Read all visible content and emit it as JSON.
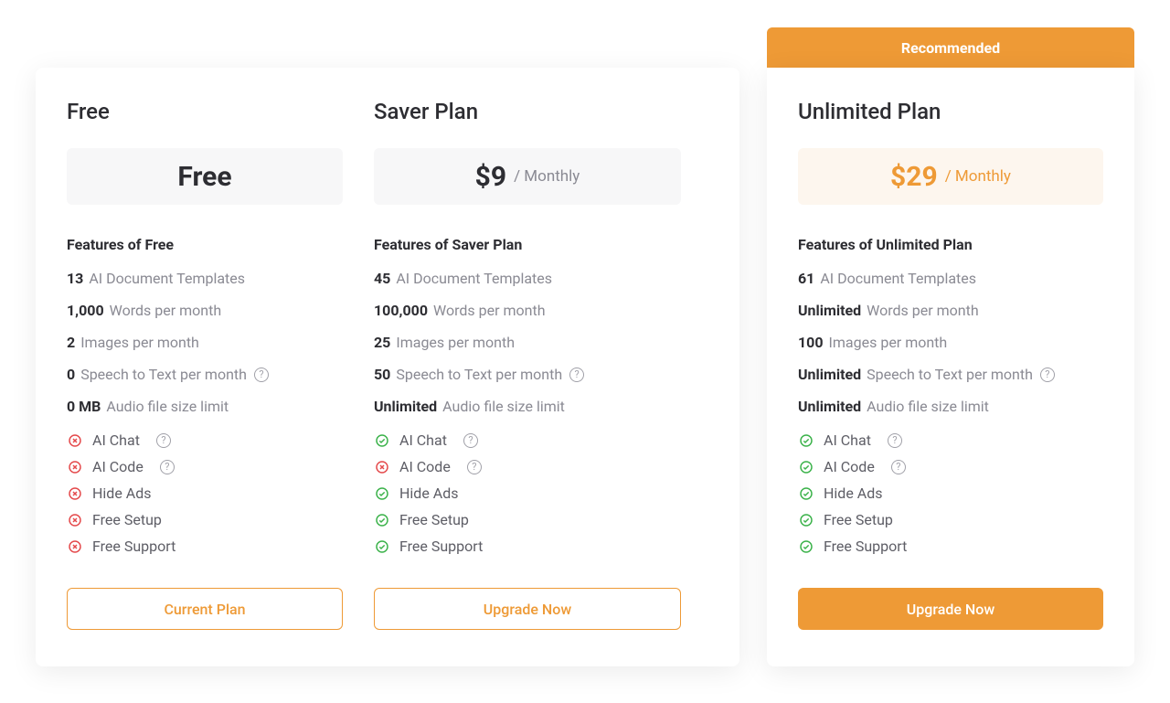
{
  "labels": {
    "recommended": "Recommended",
    "features_of": "Features of",
    "period": "/ Monthly",
    "feat_templates": "AI Document Templates",
    "feat_words": "Words per month",
    "feat_images": "Images per month",
    "feat_speech": "Speech to Text per month",
    "feat_audio": "Audio file size limit",
    "chk_chat": "AI Chat",
    "chk_code": "AI Code",
    "chk_ads": "Hide Ads",
    "chk_setup": "Free Setup",
    "chk_support": "Free Support",
    "btn_current": "Current Plan",
    "btn_upgrade": "Upgrade Now"
  },
  "plans": {
    "free": {
      "name": "Free",
      "price": "Free",
      "show_period": false,
      "quota": {
        "templates": "13",
        "words": "1,000",
        "images": "2",
        "speech": "0",
        "audio": "0 MB"
      },
      "checks": {
        "chat": false,
        "code": false,
        "ads": false,
        "setup": false,
        "support": false
      },
      "cta": "current"
    },
    "saver": {
      "name": "Saver Plan",
      "price": "$9",
      "show_period": true,
      "quota": {
        "templates": "45",
        "words": "100,000",
        "images": "25",
        "speech": "50",
        "audio": "Unlimited"
      },
      "checks": {
        "chat": true,
        "code": false,
        "ads": true,
        "setup": true,
        "support": true
      },
      "cta": "upgrade"
    },
    "unlimited": {
      "name": "Unlimited Plan",
      "price": "$29",
      "show_period": true,
      "recommended": true,
      "quota": {
        "templates": "61",
        "words": "Unlimited",
        "images": "100",
        "speech": "Unlimited",
        "audio": "Unlimited"
      },
      "checks": {
        "chat": true,
        "code": true,
        "ads": true,
        "setup": true,
        "support": true
      },
      "cta": "upgrade_filled"
    }
  }
}
